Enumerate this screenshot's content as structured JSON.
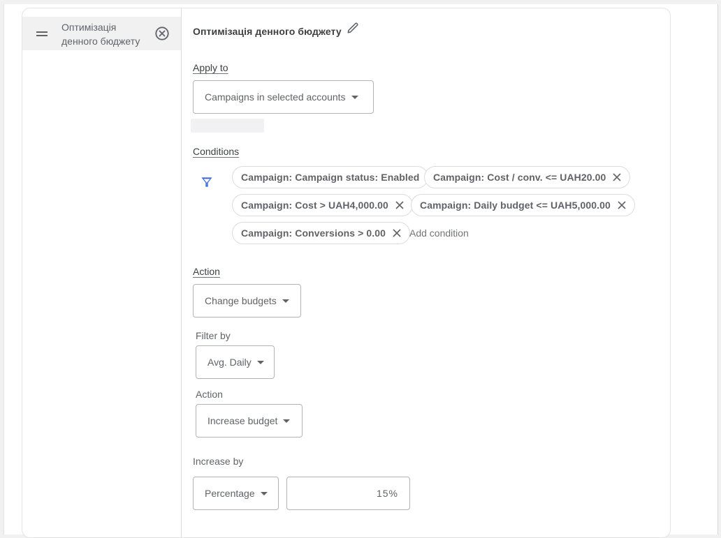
{
  "rail": {
    "item_label": "Оптимізація денного бюджету"
  },
  "rule": {
    "title": "Оптимізація денного бюджету",
    "apply_to": {
      "label": "Apply to",
      "selected": "Campaigns in selected accounts"
    },
    "conditions": {
      "label": "Conditions",
      "chips": [
        {
          "text": "Campaign: Campaign status: Enabled",
          "removable": false
        },
        {
          "text": "Campaign: Cost / conv. <= UAH20.00",
          "removable": true
        },
        {
          "text": "Campaign: Cost > UAH4,000.00",
          "removable": true
        },
        {
          "text": "Campaign: Daily budget <= UAH5,000.00",
          "removable": true
        },
        {
          "text": "Campaign: Conversions > 0.00",
          "removable": true
        }
      ],
      "add_label": "Add condition"
    },
    "action": {
      "label": "Action",
      "selected": "Change budgets",
      "filter_by": {
        "label": "Filter by",
        "selected": "Avg. Daily"
      },
      "sub_action": {
        "label": "Action",
        "selected": "Increase budget"
      },
      "increase_by": {
        "label": "Increase by",
        "type_selected": "Percentage",
        "value": "15%"
      }
    }
  },
  "colors": {
    "accent_icon": "#3367d6",
    "text": "#3c4043",
    "muted_text": "#5f6368"
  }
}
